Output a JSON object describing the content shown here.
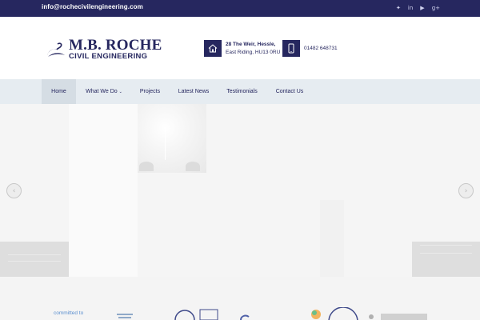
{
  "topbar": {
    "email": "info@rochecivilengineering.com",
    "social": [
      {
        "icon": "twitter-icon",
        "glyph": "✦"
      },
      {
        "icon": "linkedin-icon",
        "glyph": "in"
      },
      {
        "icon": "youtube-icon",
        "glyph": "▶"
      },
      {
        "icon": "google-plus-icon",
        "glyph": "g+"
      }
    ]
  },
  "header": {
    "logo": {
      "name": "M.B. ROCHE",
      "subtitle": "CIVIL ENGINEERING"
    },
    "address": {
      "line1": "28 The Weir, Hessle,",
      "line2": "East Riding, HU13 0RU",
      "icon": "home-icon"
    },
    "phone": {
      "number": "01482 648731",
      "icon": "mobile-icon"
    }
  },
  "nav": {
    "items": [
      {
        "label": "Home",
        "active": true
      },
      {
        "label": "What We Do",
        "dropdown": true
      },
      {
        "label": "Projects"
      },
      {
        "label": "Latest News"
      },
      {
        "label": "Testimonials"
      },
      {
        "label": "Contact Us"
      }
    ]
  },
  "slider": {
    "prev_icon": "chevron-left-icon",
    "next_icon": "chevron-right-icon",
    "prev_glyph": "‹",
    "next_glyph": "›"
  },
  "partners": {
    "committed_text": "committed to"
  },
  "colors": {
    "brand_navy": "#26275f",
    "nav_bg": "#e6ecf1",
    "nav_active_bg": "#d5dde4"
  }
}
